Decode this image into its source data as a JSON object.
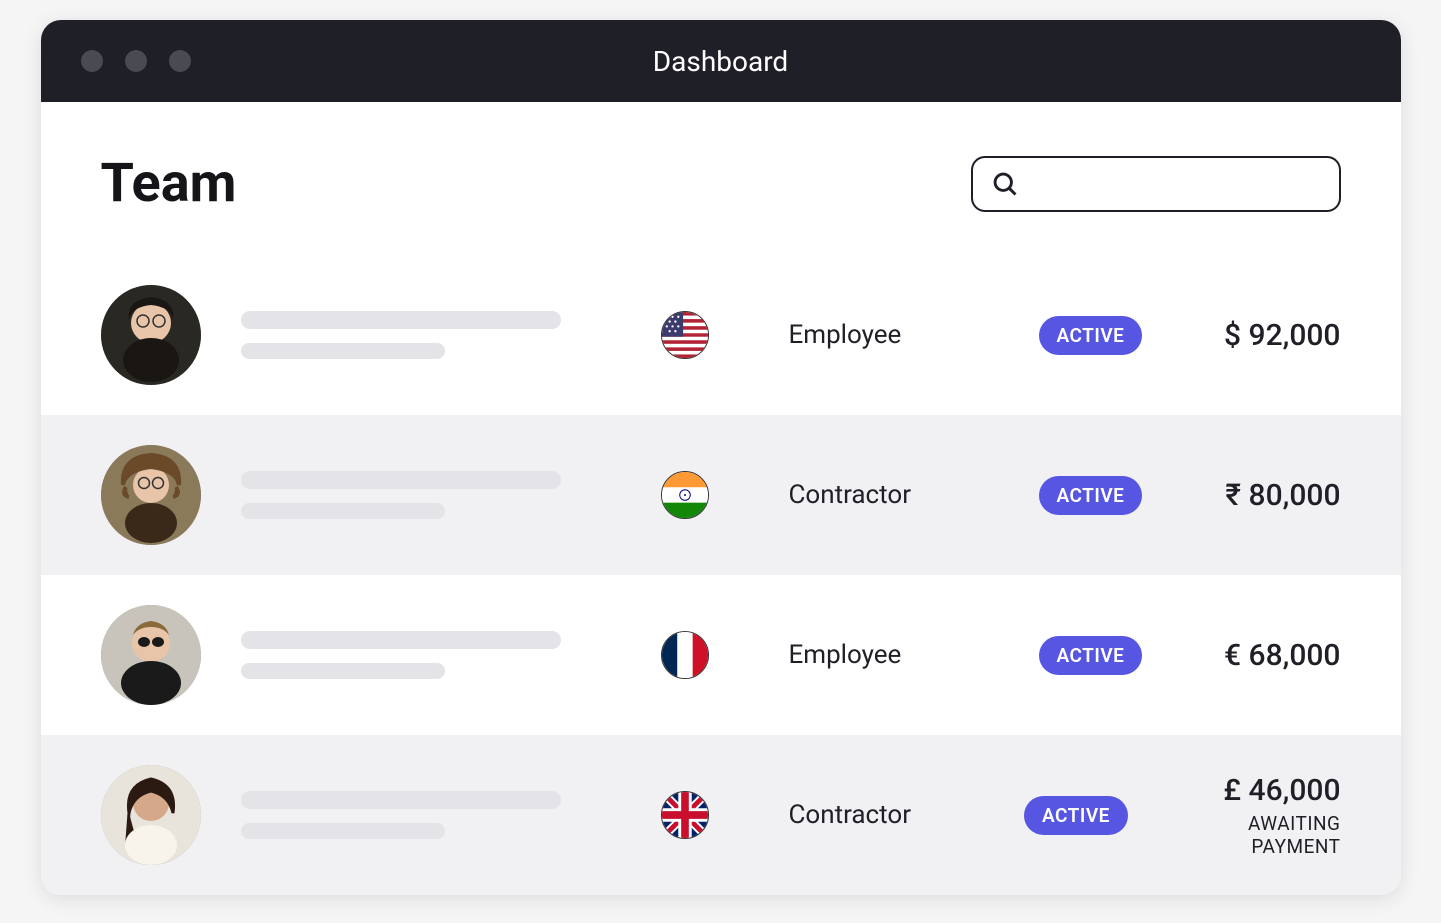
{
  "window": {
    "title": "Dashboard"
  },
  "page": {
    "title": "Team"
  },
  "search": {
    "placeholder": ""
  },
  "status_label": "ACTIVE",
  "rows": [
    {
      "country": "usa",
      "role": "Employee",
      "status": "ACTIVE",
      "salary": "$ 92,000",
      "sub": ""
    },
    {
      "country": "india",
      "role": "Contractor",
      "status": "ACTIVE",
      "salary": "₹ 80,000",
      "sub": ""
    },
    {
      "country": "france",
      "role": "Employee",
      "status": "ACTIVE",
      "salary": "€ 68,000",
      "sub": ""
    },
    {
      "country": "uk",
      "role": "Contractor",
      "status": "ACTIVE",
      "salary": "£ 46,000",
      "sub": "AWAITING PAYMENT"
    }
  ]
}
